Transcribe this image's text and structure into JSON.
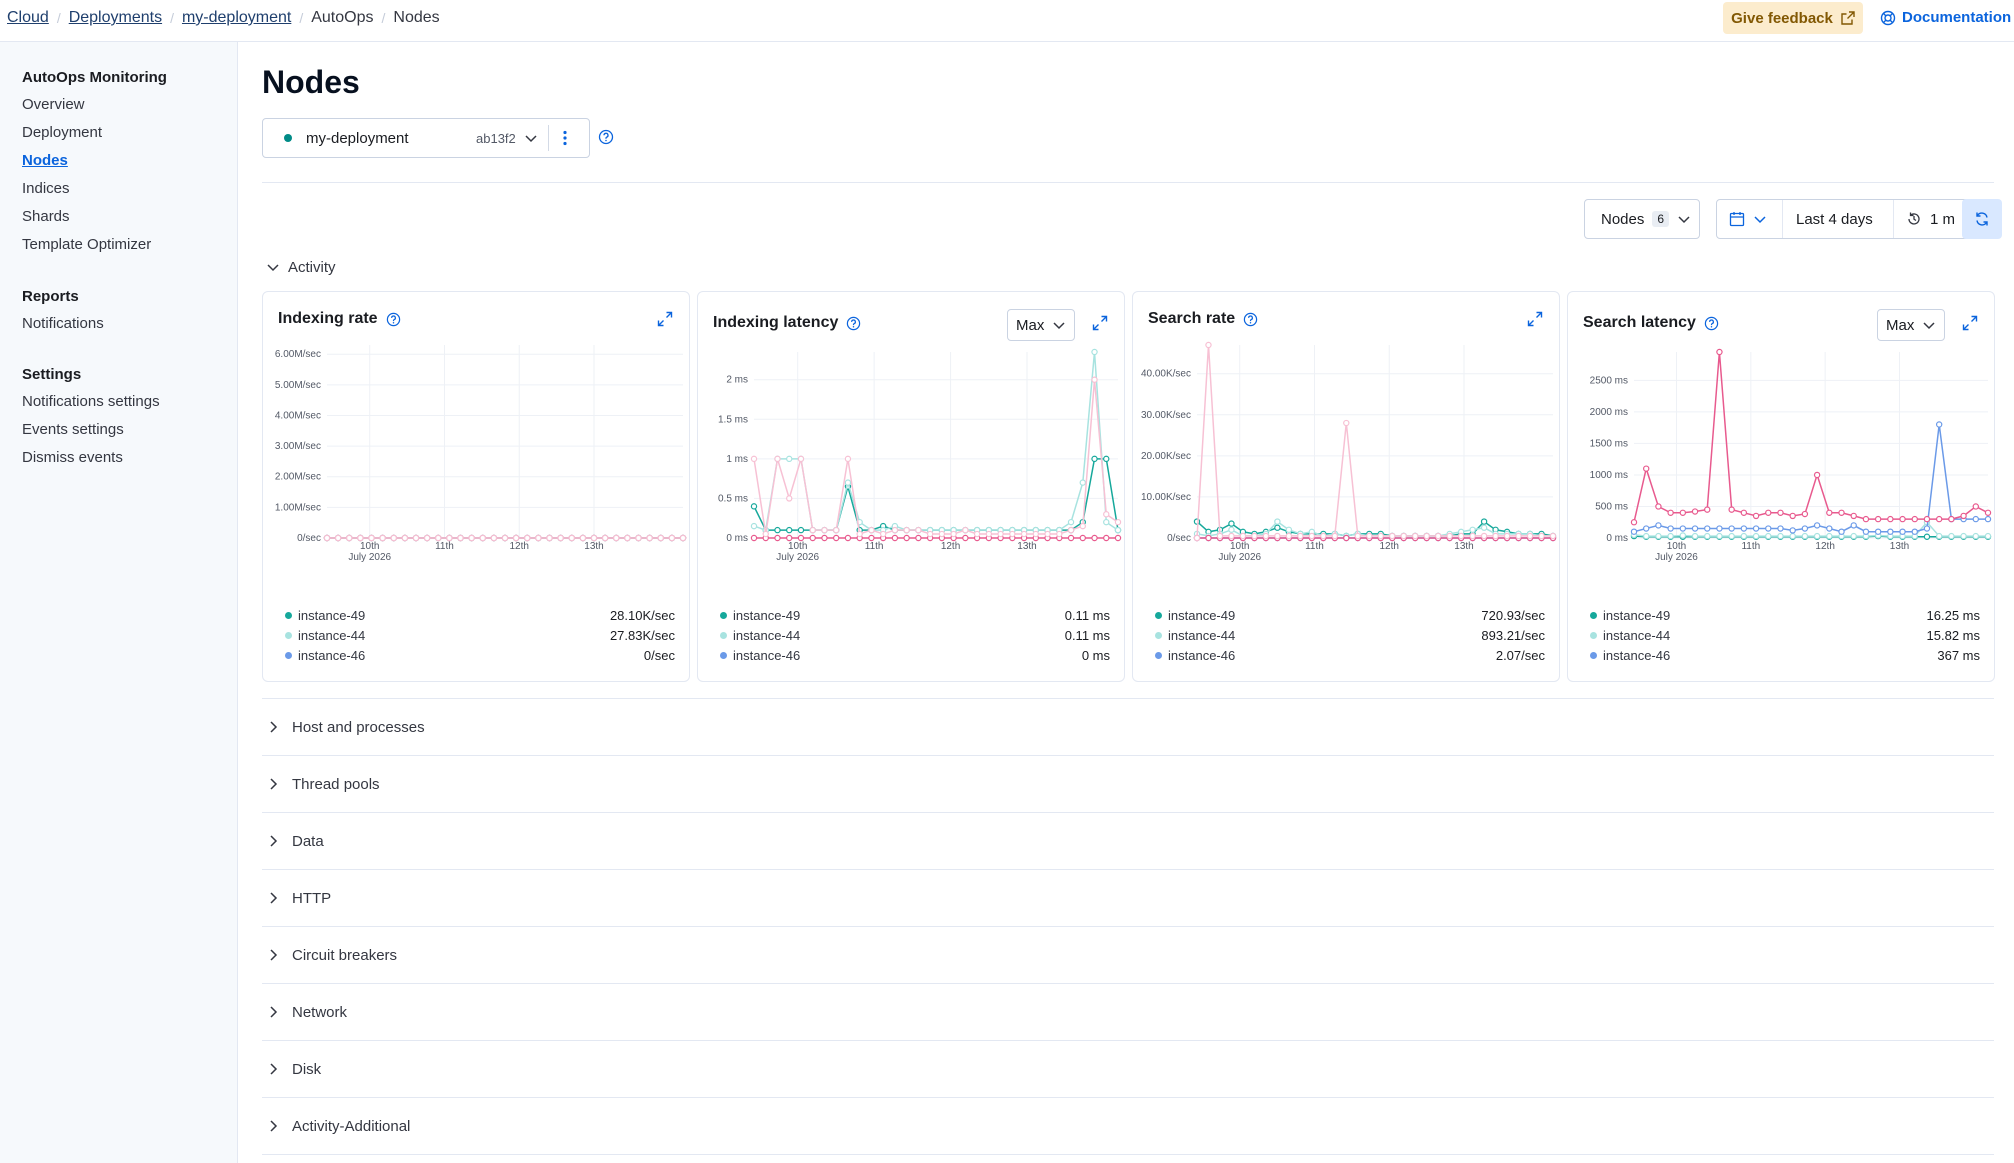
{
  "breadcrumbs": [
    "Cloud",
    "Deployments",
    "my-deployment",
    "AutoOps",
    "Nodes"
  ],
  "header": {
    "feedback_label": "Give feedback",
    "docs_label": "Documentation"
  },
  "sidebar": {
    "groups": [
      {
        "title": "AutoOps Monitoring",
        "items": [
          "Overview",
          "Deployment",
          "Nodes",
          "Indices",
          "Shards",
          "Template Optimizer"
        ]
      },
      {
        "title": "Reports",
        "items": [
          "Notifications"
        ]
      },
      {
        "title": "Settings",
        "items": [
          "Notifications settings",
          "Events settings",
          "Dismiss events"
        ]
      }
    ],
    "active_item": "Nodes"
  },
  "page": {
    "title": "Nodes"
  },
  "deployment": {
    "name": "my-deployment",
    "id": "ab13f2",
    "status_color": "#008b87"
  },
  "toolbar": {
    "nodes_label": "Nodes",
    "nodes_count": "6",
    "time_range": "Last 4 days",
    "interval": "1 m"
  },
  "sections": {
    "open": "Activity",
    "collapsed": [
      "Host and processes",
      "Thread pools",
      "Data",
      "HTTP",
      "Circuit breakers",
      "Network",
      "Disk",
      "Activity-Additional"
    ]
  },
  "colors": {
    "instance-49": "#16a89b",
    "instance-44": "#a8e3e0",
    "instance-46": "#6b9ae8",
    "instance-pink": "#e85a8e",
    "instance-lightpink": "#f7c1d4"
  },
  "panels": [
    {
      "title": "Indexing rate",
      "has_aggregation": false,
      "legend": [
        {
          "name": "instance-49",
          "value": "28.10K/sec"
        },
        {
          "name": "instance-44",
          "value": "27.83K/sec"
        },
        {
          "name": "instance-46",
          "value": "0/sec"
        }
      ]
    },
    {
      "title": "Indexing latency",
      "has_aggregation": true,
      "aggregation": "Max",
      "legend": [
        {
          "name": "instance-49",
          "value": "0.11 ms"
        },
        {
          "name": "instance-44",
          "value": "0.11 ms"
        },
        {
          "name": "instance-46",
          "value": "0 ms"
        }
      ]
    },
    {
      "title": "Search rate",
      "has_aggregation": false,
      "legend": [
        {
          "name": "instance-49",
          "value": "720.93/sec"
        },
        {
          "name": "instance-44",
          "value": "893.21/sec"
        },
        {
          "name": "instance-46",
          "value": "2.07/sec"
        }
      ]
    },
    {
      "title": "Search latency",
      "has_aggregation": true,
      "aggregation": "Max",
      "legend": [
        {
          "name": "instance-49",
          "value": "16.25 ms"
        },
        {
          "name": "instance-44",
          "value": "15.82 ms"
        },
        {
          "name": "instance-46",
          "value": "367 ms"
        }
      ]
    }
  ],
  "chart_data": [
    {
      "type": "line",
      "title": "Indexing rate",
      "ylim": [
        0,
        6300000
      ],
      "y_ticks": [
        "0/sec",
        "1.00M/sec",
        "2.00M/sec",
        "3.00M/sec",
        "4.00M/sec",
        "5.00M/sec",
        "6.00M/sec"
      ],
      "x_ticks": [
        "10th",
        "11th",
        "12th",
        "13th"
      ],
      "x_sub": "July 2026",
      "series": [
        {
          "name": "instance-49",
          "color": "#16a89b",
          "values": [
            0.01,
            0.02,
            0,
            0,
            0,
            0,
            0,
            0,
            0,
            0,
            0,
            0,
            0,
            0,
            0,
            0,
            0,
            0,
            0,
            0,
            0,
            0,
            0,
            0,
            0,
            0.01,
            0,
            0,
            0,
            0,
            0,
            0,
            0
          ]
        },
        {
          "name": "instance-44",
          "color": "#a8e3e0",
          "values": [
            0.01,
            0.02,
            0.1,
            0,
            0,
            0,
            0,
            0,
            0,
            0,
            0,
            0,
            0,
            0,
            0,
            0,
            0,
            0,
            0,
            0.05,
            0.3,
            0.05,
            0,
            0,
            0,
            0.02,
            0,
            0,
            0,
            0,
            0,
            0,
            0
          ]
        },
        {
          "name": "pink",
          "color": "#e85a8e",
          "values": [
            0,
            0,
            0,
            0,
            0,
            0,
            0,
            0,
            0,
            0,
            0,
            0,
            0,
            0,
            0,
            0,
            0,
            0,
            0,
            0,
            0,
            0,
            0,
            0,
            0,
            0,
            0,
            0,
            0,
            0,
            0,
            0,
            0
          ]
        },
        {
          "name": "lightpink",
          "color": "#f7c1d4",
          "values": [
            0,
            0,
            6.2,
            0,
            0,
            0,
            0,
            0,
            0,
            0,
            0,
            0,
            0,
            0,
            0,
            0,
            0,
            0.35,
            0,
            0,
            0,
            0,
            0,
            0,
            0,
            0.1,
            0,
            0,
            0,
            0,
            0,
            0,
            0
          ]
        }
      ]
    },
    {
      "type": "line",
      "title": "Indexing latency",
      "ylim": [
        0,
        2.35
      ],
      "y_ticks": [
        "0 ms",
        "0.5 ms",
        "1 ms",
        "1.5 ms",
        "2 ms"
      ],
      "x_ticks": [
        "10th",
        "11th",
        "12th",
        "13th"
      ],
      "x_sub": "July 2026",
      "series": [
        {
          "name": "instance-49",
          "color": "#16a89b",
          "values": [
            0.4,
            0.1,
            0.1,
            0.1,
            0.1,
            0.1,
            0.1,
            0.1,
            0.65,
            0.1,
            0.1,
            0.15,
            0.1,
            0.1,
            0.1,
            0.1,
            0.1,
            0.1,
            0.1,
            0.1,
            0.1,
            0.1,
            0.1,
            0.1,
            0.1,
            0.1,
            0.1,
            0.1,
            0.2,
            1.0,
            1.0,
            0.1
          ]
        },
        {
          "name": "instance-44",
          "color": "#a8e3e0",
          "values": [
            0.15,
            0.1,
            1.0,
            1.0,
            1.0,
            0.1,
            0.1,
            0.1,
            0.7,
            0.2,
            0.1,
            0.1,
            0.15,
            0.1,
            0.1,
            0.1,
            0.1,
            0.1,
            0.1,
            0.1,
            0.1,
            0.1,
            0.1,
            0.1,
            0.1,
            0.1,
            0.1,
            0.2,
            0.7,
            2.35,
            0.2,
            0.1
          ]
        },
        {
          "name": "pink",
          "color": "#e85a8e",
          "values": [
            0,
            0,
            0,
            0,
            0,
            0,
            0,
            0,
            0,
            0,
            0,
            0,
            0,
            0,
            0,
            0,
            0,
            0,
            0,
            0,
            0,
            0,
            0,
            0,
            0,
            0,
            0,
            0,
            0,
            0,
            0,
            0
          ]
        },
        {
          "name": "lightpink",
          "color": "#f7c1d4",
          "values": [
            1.0,
            0.05,
            1.0,
            0.5,
            1.0,
            0.1,
            0.1,
            0.1,
            1.0,
            0.05,
            0.1,
            0.05,
            0.1,
            0.1,
            0.1,
            0.05,
            0.05,
            0.05,
            0.1,
            0.05,
            0.05,
            0.05,
            0.05,
            0.05,
            0.05,
            0.05,
            0.05,
            0.1,
            0.15,
            2.0,
            0.3,
            0.2
          ]
        }
      ]
    },
    {
      "type": "line",
      "title": "Search rate",
      "ylim": [
        0,
        47000
      ],
      "y_ticks": [
        "0/sec",
        "10.00K/sec",
        "20.00K/sec",
        "30.00K/sec",
        "40.00K/sec"
      ],
      "x_ticks": [
        "10th",
        "11th",
        "12th",
        "13th"
      ],
      "x_sub": "July 2026",
      "series": [
        {
          "name": "instance-49",
          "color": "#16a89b",
          "values": [
            4000,
            1500,
            2000,
            3500,
            1500,
            1000,
            1500,
            2500,
            1500,
            1000,
            1000,
            1000,
            1000,
            500,
            1000,
            1000,
            1000,
            500,
            500,
            500,
            500,
            500,
            500,
            1000,
            1000,
            4000,
            2000,
            1500,
            1000,
            1000,
            1000,
            500
          ]
        },
        {
          "name": "instance-44",
          "color": "#a8e3e0",
          "values": [
            1000,
            500,
            1000,
            2000,
            500,
            500,
            1000,
            4000,
            2000,
            1000,
            1500,
            500,
            1000,
            500,
            1000,
            500,
            500,
            500,
            500,
            500,
            500,
            500,
            1000,
            1500,
            2000,
            2500,
            1000,
            1000,
            1000,
            1000,
            500,
            500
          ]
        },
        {
          "name": "instance-46",
          "color": "#6b9ae8",
          "values": [
            0,
            0,
            0,
            0,
            0,
            0,
            0,
            0,
            0,
            0,
            0,
            0,
            0,
            0,
            0,
            0,
            0,
            0,
            0,
            0,
            0,
            0,
            0,
            0,
            0,
            0,
            0,
            0,
            0,
            0,
            0,
            0
          ]
        },
        {
          "name": "pink",
          "color": "#e85a8e",
          "values": [
            0,
            0,
            0,
            0,
            0,
            0,
            0,
            0,
            0,
            0,
            0,
            0,
            0,
            0,
            0,
            0,
            0,
            0,
            0,
            0,
            0,
            0,
            0,
            0,
            0,
            0,
            0,
            0,
            0,
            0,
            0,
            0
          ]
        },
        {
          "name": "lightpink",
          "color": "#f7c1d4",
          "values": [
            0,
            47000,
            500,
            500,
            500,
            500,
            500,
            500,
            500,
            500,
            500,
            500,
            500,
            28000,
            500,
            500,
            500,
            500,
            500,
            500,
            500,
            500,
            500,
            500,
            500,
            500,
            500,
            500,
            500,
            500,
            500,
            500
          ]
        }
      ]
    },
    {
      "type": "line",
      "title": "Search latency",
      "ylim": [
        0,
        2950
      ],
      "y_ticks": [
        "0 ms",
        "500 ms",
        "1000 ms",
        "1500 ms",
        "2000 ms",
        "2500 ms"
      ],
      "x_ticks": [
        "10th",
        "11th",
        "12th",
        "13th"
      ],
      "x_sub": "July 2026",
      "series": [
        {
          "name": "instance-49",
          "color": "#16a89b",
          "values": [
            30,
            20,
            20,
            20,
            20,
            20,
            20,
            20,
            20,
            20,
            20,
            20,
            20,
            20,
            20,
            20,
            20,
            20,
            20,
            20,
            30,
            20,
            20,
            20,
            20,
            20,
            20,
            20,
            20,
            20
          ]
        },
        {
          "name": "instance-44",
          "color": "#a8e3e0",
          "values": [
            50,
            30,
            30,
            30,
            40,
            30,
            30,
            30,
            30,
            30,
            30,
            30,
            30,
            30,
            30,
            30,
            30,
            30,
            30,
            30,
            40,
            30,
            30,
            30,
            250,
            30,
            30,
            30,
            30,
            30
          ]
        },
        {
          "name": "instance-46",
          "color": "#6b9ae8",
          "values": [
            100,
            150,
            200,
            150,
            150,
            150,
            150,
            150,
            150,
            150,
            150,
            150,
            150,
            120,
            150,
            200,
            150,
            100,
            200,
            100,
            100,
            100,
            100,
            100,
            150,
            1800,
            300,
            300,
            300,
            300
          ]
        },
        {
          "name": "pink",
          "color": "#e85a8e",
          "values": [
            250,
            1100,
            500,
            400,
            400,
            420,
            450,
            2950,
            450,
            400,
            350,
            400,
            400,
            350,
            380,
            1000,
            400,
            400,
            350,
            300,
            300,
            300,
            300,
            300,
            300,
            300,
            300,
            350,
            500,
            400
          ]
        }
      ]
    }
  ]
}
